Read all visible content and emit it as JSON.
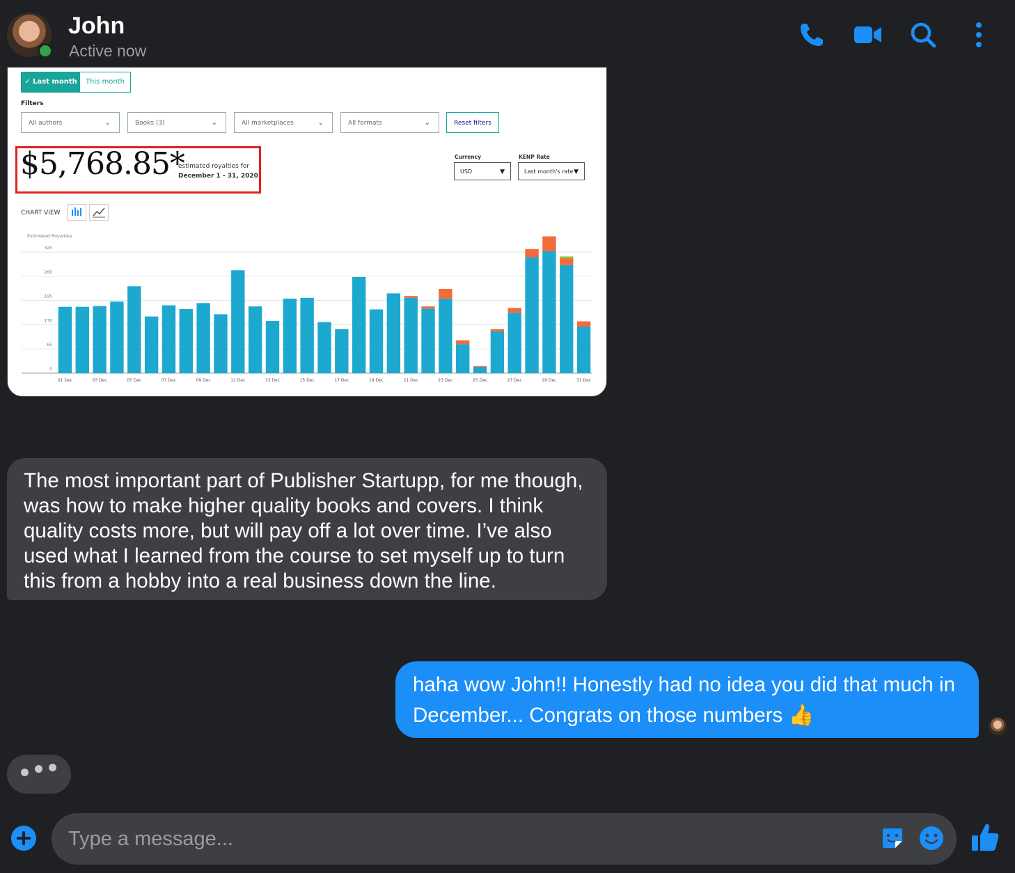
{
  "header": {
    "name": "John",
    "status": "Active now",
    "accent": "#1b8ef8",
    "icons": [
      "phone-icon",
      "video-icon",
      "search-icon",
      "more-icon"
    ]
  },
  "shared_image": {
    "tabs": [
      "✓ Last month",
      "This month"
    ],
    "filters_label": "Filters",
    "filters": [
      "All authors",
      "Books (3)",
      "All marketplaces",
      "All formats"
    ],
    "reset": "Reset filters",
    "amount": "$5,768.85*",
    "estimated_label": "estimated royalties for",
    "period": "December 1 - 31, 2020",
    "currency_label": "Currency",
    "currency_value": "USD",
    "kenp_label": "KENP Rate",
    "kenp_value": "Last month's rate",
    "chart_view": "CHART VIEW"
  },
  "chart_data": {
    "type": "bar",
    "ylabel": "Estimated Royalties",
    "yticks": [
      0,
      65,
      130,
      195,
      260,
      325
    ],
    "ylim": [
      0,
      325
    ],
    "xtick_labels": [
      "01 Dec",
      "03 Dec",
      "05 Dec",
      "07 Dec",
      "09 Dec",
      "11 Dec",
      "13 Dec",
      "15 Dec",
      "17 Dec",
      "19 Dec",
      "21 Dec",
      "23 Dec",
      "25 Dec",
      "27 Dec",
      "29 Dec",
      "31 Dec"
    ],
    "categories": [
      "01 Dec",
      "02 Dec",
      "03 Dec",
      "04 Dec",
      "05 Dec",
      "06 Dec",
      "07 Dec",
      "08 Dec",
      "09 Dec",
      "10 Dec",
      "11 Dec",
      "12 Dec",
      "13 Dec",
      "14 Dec",
      "15 Dec",
      "16 Dec",
      "17 Dec",
      "18 Dec",
      "19 Dec",
      "20 Dec",
      "21 Dec",
      "22 Dec",
      "23 Dec",
      "24 Dec",
      "25 Dec",
      "26 Dec",
      "27 Dec",
      "28 Dec",
      "29 Dec",
      "30 Dec",
      "31 Dec"
    ],
    "series": [
      {
        "color": "#1da8d0",
        "values": [
          178,
          178,
          180,
          192,
          233,
          152,
          182,
          172,
          188,
          158,
          276,
          179,
          140,
          200,
          202,
          137,
          118,
          258,
          171,
          214,
          202,
          173,
          200,
          78,
          17,
          112,
          162,
          311,
          327,
          290,
          125
        ]
      },
      {
        "color": "#f26b3a",
        "values": [
          0,
          0,
          0,
          0,
          0,
          0,
          0,
          0,
          0,
          0,
          0,
          0,
          0,
          0,
          0,
          0,
          0,
          0,
          0,
          0,
          5,
          6,
          26,
          10,
          2,
          6,
          13,
          22,
          40,
          18,
          14
        ]
      },
      {
        "color": "#8fbf3f",
        "values": [
          0,
          0,
          0,
          0,
          0,
          0,
          0,
          0,
          0,
          0,
          0,
          0,
          0,
          0,
          0,
          0,
          0,
          0,
          0,
          0,
          0,
          0,
          0,
          0,
          0,
          0,
          0,
          0,
          0,
          5,
          0
        ]
      }
    ],
    "grid": true,
    "legend": "none"
  },
  "messages": {
    "incoming": "The most important part of Publisher Startupp, for me though, was how to make higher quality books and covers. I think quality costs more, but will pay off a lot over time. I’ve also used what I learned from the course to set myself up to turn this from a hobby into a real business down the line.",
    "outgoing": "haha wow John!! Honestly had no idea you did that much in December... Congrats on those numbers 👍"
  },
  "composer": {
    "placeholder": "Type a message...",
    "icons": [
      "add-icon",
      "sticker-icon",
      "emoji-icon",
      "thumbs-up-icon"
    ]
  }
}
